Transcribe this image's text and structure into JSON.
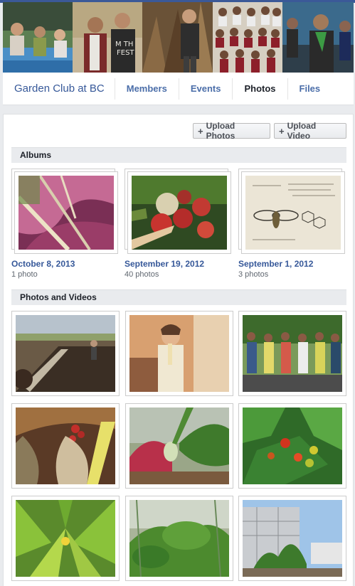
{
  "group": {
    "name": "Garden Club at BC"
  },
  "nav": {
    "tabs": [
      {
        "label": "Members"
      },
      {
        "label": "Events"
      },
      {
        "label": "Photos"
      },
      {
        "label": "Files"
      }
    ],
    "active_tab": "Photos"
  },
  "toolbar": {
    "upload_photos_label": "Upload Photos",
    "upload_video_label": "Upload Video"
  },
  "albums_section": {
    "title": "Albums",
    "items": [
      {
        "date": "October 8, 2013",
        "count": "1 photo"
      },
      {
        "date": "September 19, 2012",
        "count": "40 photos"
      },
      {
        "date": "September 1, 2012",
        "count": "3 photos"
      }
    ]
  },
  "media_section": {
    "title": "Photos and Videos"
  },
  "colors": {
    "brand_blue": "#3b5998",
    "link_blue": "#365899",
    "section_gray": "#e9ebee"
  }
}
